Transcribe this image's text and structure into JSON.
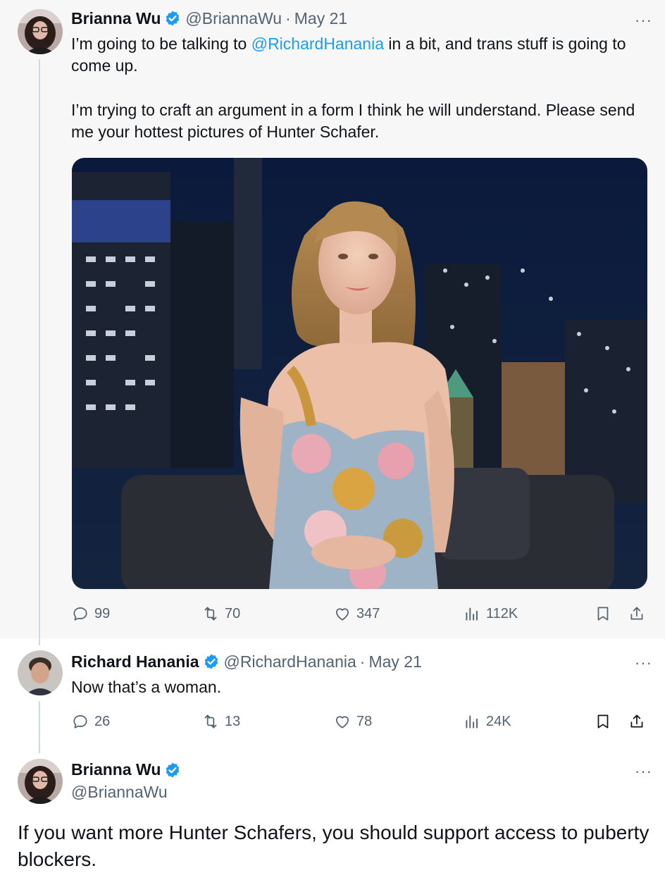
{
  "tweet1": {
    "name": "Brianna Wu",
    "handle": "@BriannaWu",
    "separator": "·",
    "date": "May 21",
    "more": "···",
    "line1_pre": "I’m going to be talking to ",
    "line1_mention": "@RichardHanania",
    "line1_post": " in a bit, and trans stuff is going to come up.",
    "paragraph2": "I’m trying to craft an argument in a form I think he will understand.  Please send me your hottest pictures of Hunter Schafer.",
    "replies": "99",
    "retweets": "70",
    "likes": "347",
    "views": "112K"
  },
  "tweet2": {
    "name": "Richard Hanania",
    "handle": "@RichardHanania",
    "separator": "·",
    "date": "May 21",
    "more": "···",
    "text": "Now that’s a woman.",
    "replies": "26",
    "retweets": "13",
    "likes": "78",
    "views": "24K"
  },
  "tweet3": {
    "name": "Brianna Wu",
    "handle": "@BriannaWu",
    "more": "···",
    "text": "If you want more Hunter Schafers, you should support access to puberty blockers."
  },
  "icons": {
    "reply": "reply-icon",
    "retweet": "retweet-icon",
    "like": "heart-icon",
    "views": "views-icon",
    "bookmark": "bookmark-icon",
    "share": "share-icon",
    "verified": "verified-badge-icon"
  },
  "colors": {
    "link": "#1d9bf0",
    "secondary_text": "#536471",
    "primary_text": "#0f1419",
    "highlight_bg": "#f7f7f7"
  }
}
